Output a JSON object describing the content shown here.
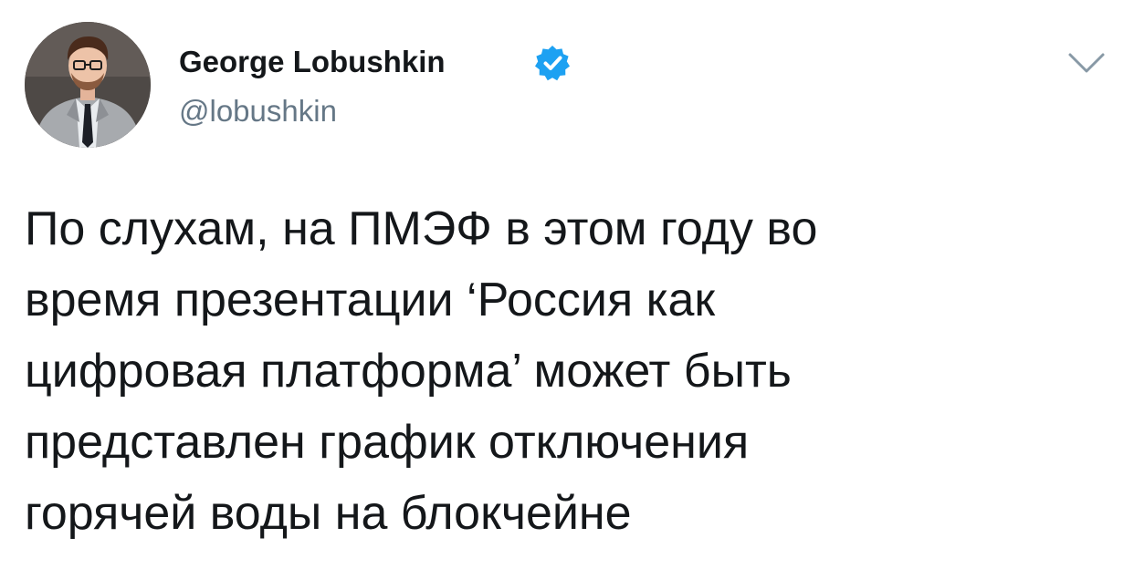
{
  "author": {
    "display_name": "George Lobushkin",
    "handle": "@lobushkin",
    "verified": true,
    "avatar_icon": "profile-photo"
  },
  "tweet": {
    "lines": [
      "По слухам, на ПМЭФ в этом году во",
      "время презентации ‘Россия как",
      "цифровая платформа’ может быть",
      "представлен график отключения",
      "горячей воды на блокчейне"
    ]
  },
  "icons": {
    "verified": "verified-badge-icon",
    "menu": "chevron-down-icon"
  },
  "colors": {
    "text": "#14171a",
    "secondary_text": "#657786",
    "verified_blue": "#1da1f2",
    "background": "#ffffff"
  }
}
